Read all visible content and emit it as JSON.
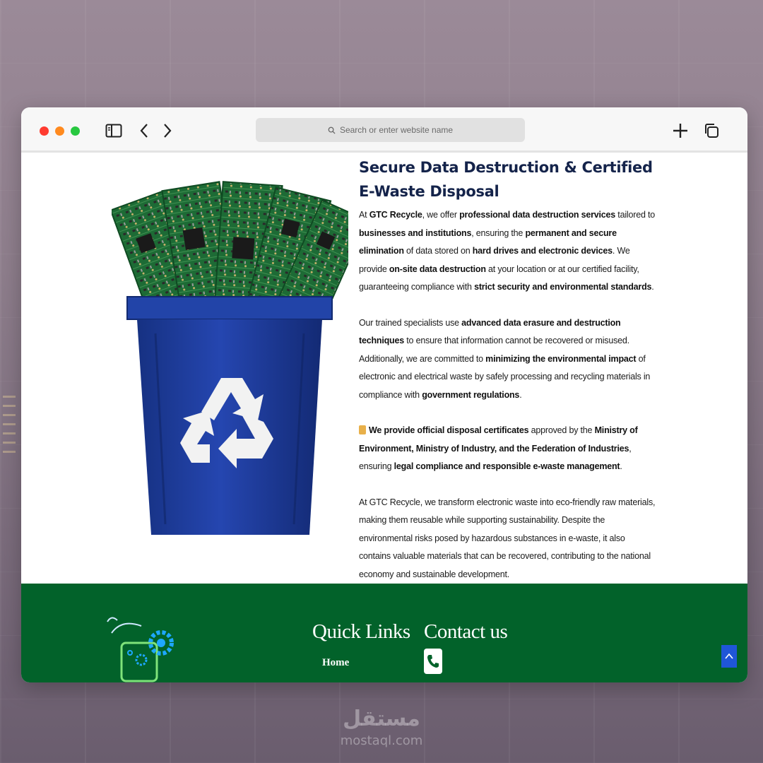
{
  "browser": {
    "search_placeholder": "Search or enter website name"
  },
  "article": {
    "title": "Secure Data Destruction & Certified E-Waste Disposal",
    "p1": [
      {
        "t": "At ",
        "b": false
      },
      {
        "t": "GTC Recycle",
        "b": true
      },
      {
        "t": ", we offer ",
        "b": false
      },
      {
        "t": "professional data destruction services",
        "b": true
      },
      {
        "t": " tailored to ",
        "b": false
      },
      {
        "t": "businesses and institutions",
        "b": true
      },
      {
        "t": ", ensuring the ",
        "b": false
      },
      {
        "t": "permanent and secure elimination",
        "b": true
      },
      {
        "t": " of data stored on ",
        "b": false
      },
      {
        "t": "hard drives and electronic devices",
        "b": true
      },
      {
        "t": ". We provide ",
        "b": false
      },
      {
        "t": "on-site data destruction",
        "b": true
      },
      {
        "t": " at your location or at our certified facility, guaranteeing compliance with ",
        "b": false
      },
      {
        "t": "strict security and environmental standards",
        "b": true
      },
      {
        "t": ".",
        "b": false
      }
    ],
    "p2": [
      {
        "t": "Our trained specialists use ",
        "b": false
      },
      {
        "t": "advanced data erasure and destruction techniques",
        "b": true
      },
      {
        "t": " to ensure that information cannot be recovered or misused. Additionally, we are committed to ",
        "b": false
      },
      {
        "t": "minimizing the environmental impact",
        "b": true
      },
      {
        "t": " of electronic and electrical waste by safely processing and recycling materials in compliance with ",
        "b": false
      },
      {
        "t": "government regulations",
        "b": true
      },
      {
        "t": ".",
        "b": false
      }
    ],
    "p3": [
      {
        "t": "We provide official disposal certificates",
        "b": true
      },
      {
        "t": " approved by the ",
        "b": false
      },
      {
        "t": "Ministry of Environment, Ministry of Industry, and the Federation of Industries",
        "b": true
      },
      {
        "t": ", ensuring ",
        "b": false
      },
      {
        "t": "legal compliance and responsible e-waste management",
        "b": true
      },
      {
        "t": ".",
        "b": false
      }
    ],
    "p4": [
      {
        "t": "At GTC Recycle, we transform electronic waste into eco-friendly raw materials, making them reusable while supporting sustainability. Despite the environmental risks posed by hazardous substances in e-waste, it also contains valuable materials that can be recovered, contributing to the national economy and sustainable development.",
        "b": false
      }
    ]
  },
  "footer": {
    "quick_links_title": "Quick Links",
    "contact_title": "Contact us",
    "links": [
      "Home"
    ]
  },
  "watermark": {
    "arabic": "مستقل",
    "latin": "mostaql.com"
  },
  "colors": {
    "footer_bg": "#02622a",
    "title_color": "#14234a",
    "bin_blue": "#1f3ea3",
    "scroll_btn": "#1f56d8"
  }
}
